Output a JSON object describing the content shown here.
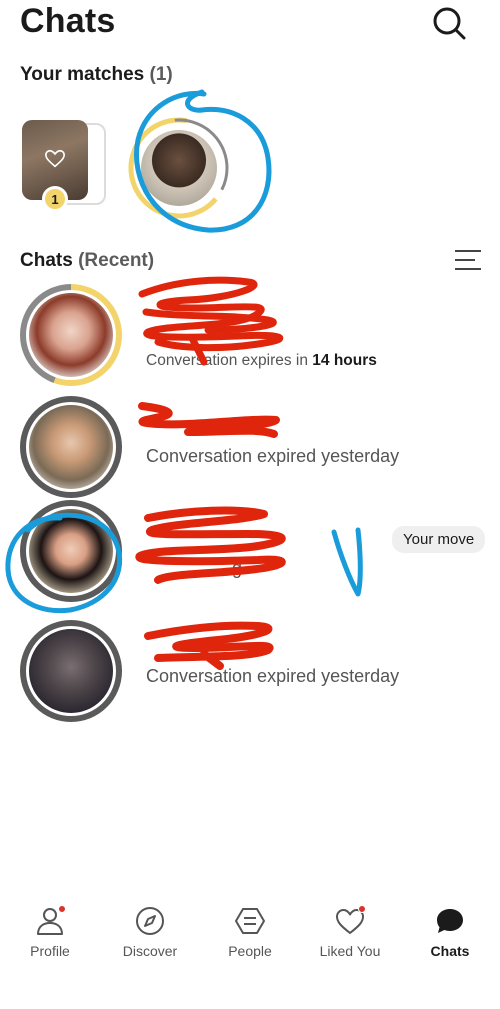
{
  "header": {
    "title": "Chats",
    "search_icon": "search-icon"
  },
  "matches": {
    "title": "Your matches",
    "count": "(1)",
    "hidden_card": {
      "icon": "heart-outline-icon",
      "badge": "1"
    },
    "ring_colors": {
      "track": "#8a8a8a",
      "progress": "#f2d46b"
    }
  },
  "chats_section": {
    "title": "Chats",
    "subtitle": "(Recent)",
    "sort_icon": "sort-lines-icon"
  },
  "chats": [
    {
      "status_prefix": "Conversation expires in",
      "status_strong": "14 hours",
      "ring": "yellow"
    },
    {
      "status": "Conversation expired yesterday",
      "ring": "dark"
    },
    {
      "status": "g",
      "badge": "Your move",
      "ring": "dark"
    },
    {
      "status": "Conversation expired yesterday",
      "ring": "dark"
    }
  ],
  "annotations": {
    "check_mark": "V",
    "ink_color": "#1a9cdb",
    "redaction_color": "#e0250d"
  },
  "nav": [
    {
      "label": "Profile",
      "icon": "profile-icon",
      "dot": true
    },
    {
      "label": "Discover",
      "icon": "compass-icon",
      "dot": false
    },
    {
      "label": "People",
      "icon": "people-icon",
      "dot": false
    },
    {
      "label": "Liked You",
      "icon": "heart-icon",
      "dot": true
    },
    {
      "label": "Chats",
      "icon": "chat-bubble-icon",
      "dot": false,
      "active": true
    }
  ],
  "colors": {
    "accent_yellow": "#f2d46b",
    "notify_red": "#d9342b",
    "text": "#1b1b1b",
    "muted": "#555555"
  }
}
